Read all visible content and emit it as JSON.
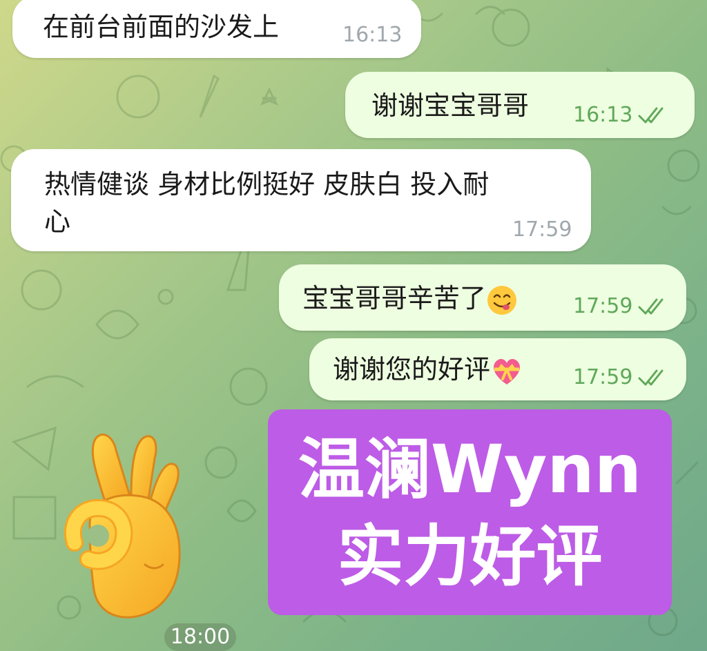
{
  "messages": [
    {
      "direction": "incoming",
      "text": "在前台前面的沙发上",
      "time": "16:13"
    },
    {
      "direction": "outgoing",
      "text": "谢谢宝宝哥哥",
      "time": "16:13",
      "status": "read-double-check"
    },
    {
      "direction": "incoming",
      "line1": "热情健谈 身材比例挺好 皮肤白 投入耐",
      "line2": "心",
      "time": "17:59"
    },
    {
      "direction": "outgoing",
      "text": "宝宝哥哥辛苦了",
      "emoji": "yum-face-emoji",
      "time": "17:59",
      "status": "read-double-check"
    },
    {
      "direction": "outgoing",
      "text": "谢谢您的好评",
      "emoji": "heart-with-ribbon-emoji",
      "time": "17:59",
      "status": "read-double-check"
    }
  ],
  "promo": {
    "line1": "温澜Wynn",
    "line2": "实力好评",
    "background": "#bd5ce6"
  },
  "sticker": {
    "emoji": "ok-hand-emoji",
    "time": "18:00"
  },
  "colors": {
    "incoming_bubble": "#ffffff",
    "outgoing_bubble": "#eefee0",
    "check_color": "#5fa85a",
    "incoming_time": "#a0a8ad"
  }
}
